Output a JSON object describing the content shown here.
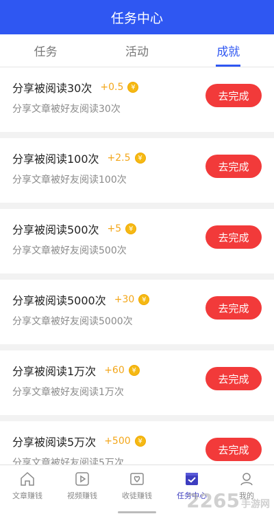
{
  "header": {
    "title": "任务中心"
  },
  "tabs": [
    {
      "label": "任务",
      "active": false
    },
    {
      "label": "活动",
      "active": false
    },
    {
      "label": "成就",
      "active": true
    }
  ],
  "tasks": [
    {
      "title": "分享被阅读30次",
      "reward": "+0.5",
      "desc": "分享文章被好友阅读30次",
      "button": "去完成"
    },
    {
      "title": "分享被阅读100次",
      "reward": "+2.5",
      "desc": "分享文章被好友阅读100次",
      "button": "去完成"
    },
    {
      "title": "分享被阅读500次",
      "reward": "+5",
      "desc": "分享文章被好友阅读500次",
      "button": "去完成"
    },
    {
      "title": "分享被阅读5000次",
      "reward": "+30",
      "desc": "分享文章被好友阅读5000次",
      "button": "去完成"
    },
    {
      "title": "分享被阅读1万次",
      "reward": "+60",
      "desc": "分享文章被好友阅读1万次",
      "button": "去完成"
    },
    {
      "title": "分享被阅读5万次",
      "reward": "+500",
      "desc": "分享文章被好友阅读5万次",
      "button": "去完成"
    }
  ],
  "coin_symbol": "¥",
  "bottom_nav": [
    {
      "label": "文章赚钱",
      "icon": "home-icon"
    },
    {
      "label": "视频赚钱",
      "icon": "video-play-icon"
    },
    {
      "label": "收徒赚钱",
      "icon": "heart-envelope-icon"
    },
    {
      "label": "任务中心",
      "icon": "task-check-icon",
      "active": true
    },
    {
      "label": "我的",
      "icon": "user-icon"
    }
  ],
  "watermark": {
    "main": "2265",
    "sub": "手游网"
  },
  "colors": {
    "primary": "#2f57f2",
    "button": "#f23a3a",
    "reward": "#f3a619"
  }
}
